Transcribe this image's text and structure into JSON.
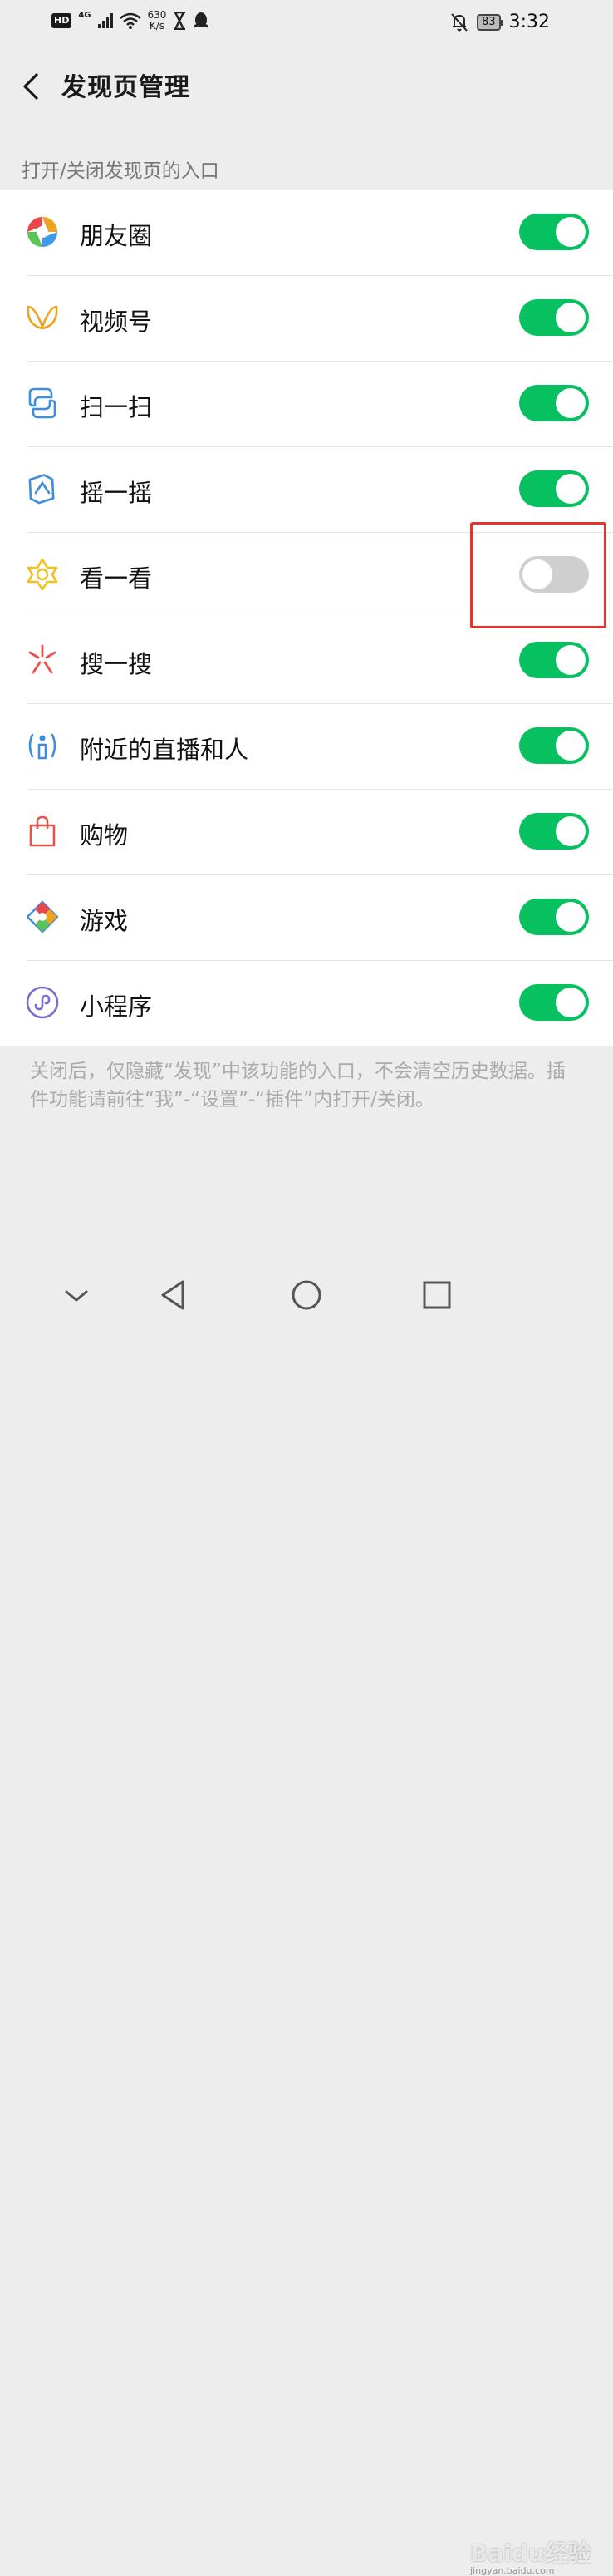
{
  "status_bar": {
    "hd": "HD",
    "network": "4G",
    "speed_value": "630",
    "speed_unit": "K/s",
    "battery": "83",
    "time": "3:32"
  },
  "header": {
    "title": "发现页管理"
  },
  "section_label": "打开/关闭发现页的入口",
  "items": [
    {
      "label": "朋友圈",
      "icon": "moments-icon",
      "enabled": true
    },
    {
      "label": "视频号",
      "icon": "channels-icon",
      "enabled": true
    },
    {
      "label": "扫一扫",
      "icon": "scan-icon",
      "enabled": true
    },
    {
      "label": "摇一摇",
      "icon": "shake-icon",
      "enabled": true
    },
    {
      "label": "看一看",
      "icon": "top-stories-icon",
      "enabled": false
    },
    {
      "label": "搜一搜",
      "icon": "search-icon",
      "enabled": true
    },
    {
      "label": "附近的直播和人",
      "icon": "nearby-icon",
      "enabled": true
    },
    {
      "label": "购物",
      "icon": "shopping-bag-icon",
      "enabled": true
    },
    {
      "label": "游戏",
      "icon": "games-icon",
      "enabled": true
    },
    {
      "label": "小程序",
      "icon": "mini-programs-icon",
      "enabled": true
    }
  ],
  "footer_note": "关闭后，仅隐藏“发现”中该功能的入口，不会清空历史数据。插件功能请前往“我”-“设置”-“插件”内打开/关闭。",
  "watermark": {
    "text": "Baidu经验",
    "sub": "jingyan.baidu.com"
  },
  "colors": {
    "toggle_on": "#07c160",
    "toggle_off": "#cfcfcf",
    "highlight": "#e8322a"
  }
}
